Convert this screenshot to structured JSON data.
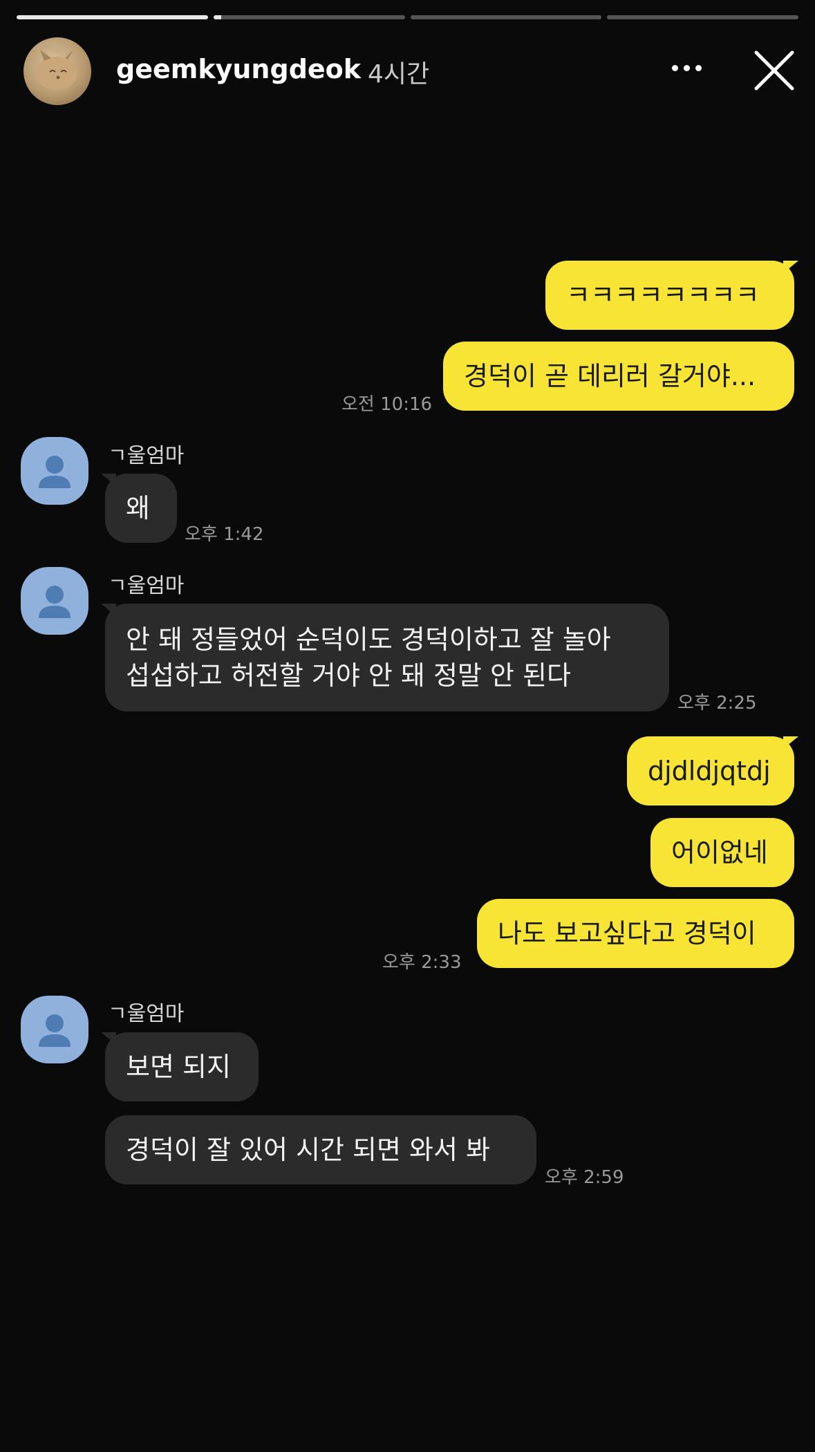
{
  "story": {
    "progress": [
      1,
      0.04,
      0,
      0
    ],
    "username": "geemkyungdeok",
    "time_ago": "4시간"
  },
  "contact": {
    "name": "ㄱ울엄마"
  },
  "messages": {
    "m1": "ㅋㅋㅋㅋㅋㅋㅋㅋ",
    "m2": "경덕이 곧 데리러 갈거야...",
    "t1": "오전 10:16",
    "m3": "왜",
    "t2": "오후 1:42",
    "m4_line1": "안 돼 정들었어 순덕이도 경덕이하고 잘 놀아",
    "m4_line2": "섭섭하고 허전할 거야 안 돼 정말 안 된다",
    "t3": "오후 2:25",
    "m5": "djdldjqtdj",
    "m6": "어이없네",
    "m7": "나도 보고싶다고 경덕이",
    "t4": "오후 2:33",
    "m8": "보면 되지",
    "m9": "경덕이 잘 있어 시간 되면 와서 봐",
    "t5": "오후 2:59"
  },
  "colors": {
    "my_bubble": "#f7e434",
    "their_bubble": "#2b2b2c",
    "profile_avatar": "#8fb1dc",
    "background": "#0a0a0b"
  },
  "icons": {
    "more": "more-dots-icon",
    "close": "close-icon",
    "profile": "person-icon"
  }
}
